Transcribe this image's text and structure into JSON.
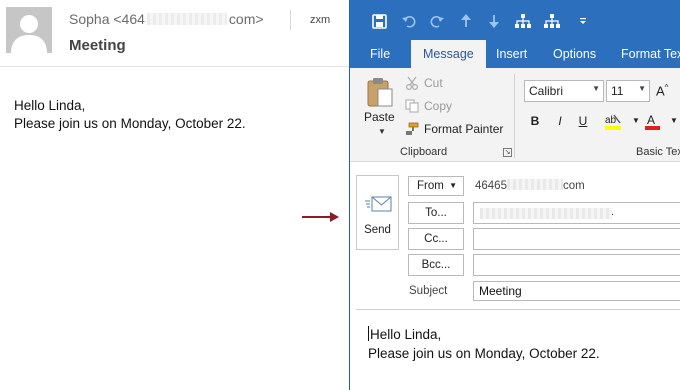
{
  "reading_pane": {
    "sender_prefix": "Sopha <464",
    "sender_suffix": "com>",
    "initials": "zxm",
    "subject": "Meeting",
    "body_line1": "Hello Linda,",
    "body_line2": "Please join us on Monday, October 22."
  },
  "compose": {
    "tabs": [
      "File",
      "Message",
      "Insert",
      "Options",
      "Format Text"
    ],
    "clipboard": {
      "paste": "Paste",
      "cut": "Cut",
      "copy": "Copy",
      "format_painter": "Format Painter",
      "group_label": "Clipboard"
    },
    "basic_text": {
      "font_name": "Calibri",
      "font_size": "11",
      "bold": "B",
      "italic": "I",
      "underline": "U",
      "group_label": "Basic Text"
    },
    "fields": {
      "send": "Send",
      "from_button": "From",
      "from_value_prefix": "46465",
      "from_value_suffix": "com",
      "to_button": "To...",
      "cc_button": "Cc...",
      "bcc_button": "Bcc...",
      "subject_label": "Subject",
      "subject_value": "Meeting"
    },
    "body_line1": "Hello Linda,",
    "body_line2": "Please join us on Monday, October 22."
  },
  "icons": [
    "save-icon",
    "undo-icon",
    "redo-icon",
    "up-arrow-icon",
    "down-arrow-icon",
    "org-chart-icon",
    "customize-qat-icon",
    "paste-icon",
    "cut-icon",
    "copy-icon",
    "format-painter-icon",
    "highlight-icon",
    "font-color-icon",
    "grow-font-icon",
    "send-envelope-icon",
    "pointer-arrow-icon"
  ],
  "colors": {
    "outlook_blue": "#2b6fbd",
    "ribbon_bg": "#f3f3f3",
    "arrow": "#8b1a2b",
    "highlight": "#ffff00",
    "font_color": "#e0201b"
  }
}
